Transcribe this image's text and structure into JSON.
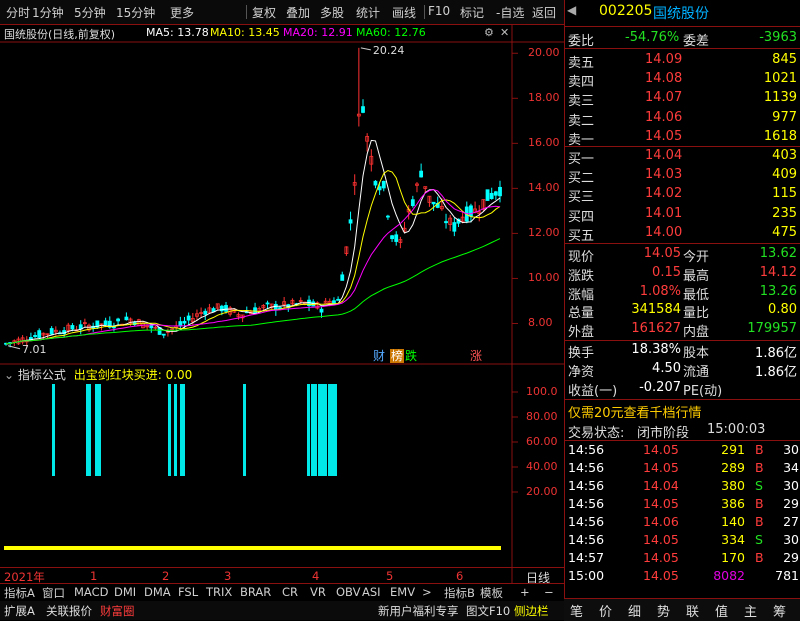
{
  "toolbar": {
    "items": [
      "分时",
      "1分钟",
      "5分钟",
      "15分钟",
      "更多",
      "复权",
      "叠加",
      "多股",
      "统计",
      "画线",
      "F10",
      "标记",
      "-自选",
      "返回"
    ]
  },
  "chart": {
    "title": "国统股份(日线,前复权)",
    "ma5": "MA5: 13.78",
    "ma10": "MA10: 13.45",
    "ma20": "MA20: 12.91",
    "ma60": "MA60: 12.76",
    "high_label": "20.24",
    "low_label": "7.01",
    "yaxis_ticks": [
      "20.00",
      "18.00",
      "16.00",
      "14.00",
      "12.00",
      "10.00",
      "8.00"
    ],
    "markers": [
      "财",
      "榜",
      "跌",
      "涨"
    ],
    "colors": {
      "ma5": "#ffffff",
      "ma10": "#ffff00",
      "ma20": "#ff00ff",
      "ma60": "#00ff00",
      "up": "#ff3232",
      "down": "#00ffff"
    }
  },
  "indicator": {
    "label": "指标公式",
    "formula": "出宝剑红块买进: 0.00",
    "yaxis_ticks": [
      "100.0",
      "80.00",
      "60.00",
      "40.00",
      "20.00"
    ]
  },
  "xaxis": {
    "year": "2021年",
    "months": [
      "1",
      "2",
      "3",
      "4",
      "5",
      "6"
    ],
    "period": "日线"
  },
  "chart_data": {
    "type": "candlestick",
    "ylim": [
      7.0,
      20.5
    ],
    "price_high": 20.24,
    "price_low": 7.01,
    "ma": {
      "ma5": 13.78,
      "ma10": 13.45,
      "ma20": 12.91,
      "ma60": 12.76
    },
    "indicator_signal_ylim": [
      0,
      100
    ]
  },
  "bottom_tabs": [
    "指标A",
    "窗口",
    "MACD",
    "DMI",
    "DMA",
    "FSL",
    "TRIX",
    "BRAR",
    "CR",
    "VR",
    "OBV",
    "ASI",
    "EMV",
    ">",
    "指标B",
    "模板"
  ],
  "status_bar": {
    "items": [
      "扩展A",
      "关联报价",
      "财富圈",
      "新用户福利专享",
      "图文F10",
      "侧边栏"
    ]
  },
  "quote": {
    "code": "002205",
    "name": "国统股份",
    "webi_label": "委比",
    "webi_value": "-54.76%",
    "weicha_label": "委差",
    "weicha_value": "-3963",
    "asks": [
      {
        "label": "卖五",
        "price": "14.09",
        "vol": "845"
      },
      {
        "label": "卖四",
        "price": "14.08",
        "vol": "1021"
      },
      {
        "label": "卖三",
        "price": "14.07",
        "vol": "1139"
      },
      {
        "label": "卖二",
        "price": "14.06",
        "vol": "977"
      },
      {
        "label": "卖一",
        "price": "14.05",
        "vol": "1618"
      }
    ],
    "bids": [
      {
        "label": "买一",
        "price": "14.04",
        "vol": "403"
      },
      {
        "label": "买二",
        "price": "14.03",
        "vol": "409"
      },
      {
        "label": "买三",
        "price": "14.02",
        "vol": "115"
      },
      {
        "label": "买四",
        "price": "14.01",
        "vol": "235"
      },
      {
        "label": "买五",
        "price": "14.00",
        "vol": "475"
      }
    ],
    "stats": [
      {
        "l1": "现价",
        "v1": "14.05",
        "l2": "今开",
        "v2": "13.62"
      },
      {
        "l1": "涨跌",
        "v1": "0.15",
        "l2": "最高",
        "v2": "14.12"
      },
      {
        "l1": "涨幅",
        "v1": "1.08%",
        "l2": "最低",
        "v2": "13.26"
      },
      {
        "l1": "总量",
        "v1": "341584",
        "l2": "量比",
        "v2": "0.80"
      },
      {
        "l1": "外盘",
        "v1": "161627",
        "l2": "内盘",
        "v2": "179957"
      }
    ],
    "stats2": [
      {
        "l1": "换手",
        "v1": "18.38%",
        "l2": "股本",
        "v2": "1.86亿"
      },
      {
        "l1": "净资",
        "v1": "4.50",
        "l2": "流通",
        "v2": "1.86亿"
      },
      {
        "l1": "收益(一)",
        "v1": "-0.207",
        "l2": "PE(动)",
        "v2": ""
      }
    ],
    "promo": "仅需20元查看千档行情",
    "trade_status_label": "交易状态:",
    "trade_status_value": "闭市阶段",
    "trade_status_time": "15:00:03",
    "ticks": [
      {
        "time": "14:56",
        "price": "14.05",
        "vol": "291",
        "bs": "B",
        "n": "30"
      },
      {
        "time": "14:56",
        "price": "14.05",
        "vol": "289",
        "bs": "B",
        "n": "34"
      },
      {
        "time": "14:56",
        "price": "14.04",
        "vol": "380",
        "bs": "S",
        "n": "30"
      },
      {
        "time": "14:56",
        "price": "14.05",
        "vol": "386",
        "bs": "B",
        "n": "29"
      },
      {
        "time": "14:56",
        "price": "14.06",
        "vol": "140",
        "bs": "B",
        "n": "27"
      },
      {
        "time": "14:56",
        "price": "14.05",
        "vol": "334",
        "bs": "S",
        "n": "30"
      },
      {
        "time": "14:57",
        "price": "14.05",
        "vol": "170",
        "bs": "B",
        "n": "29"
      },
      {
        "time": "15:00",
        "price": "14.05",
        "vol": "8082",
        "bs": "",
        "n": "781"
      }
    ],
    "bottom_icons": [
      "笔",
      "价",
      "细",
      "势",
      "联",
      "值",
      "主",
      "筹"
    ]
  }
}
